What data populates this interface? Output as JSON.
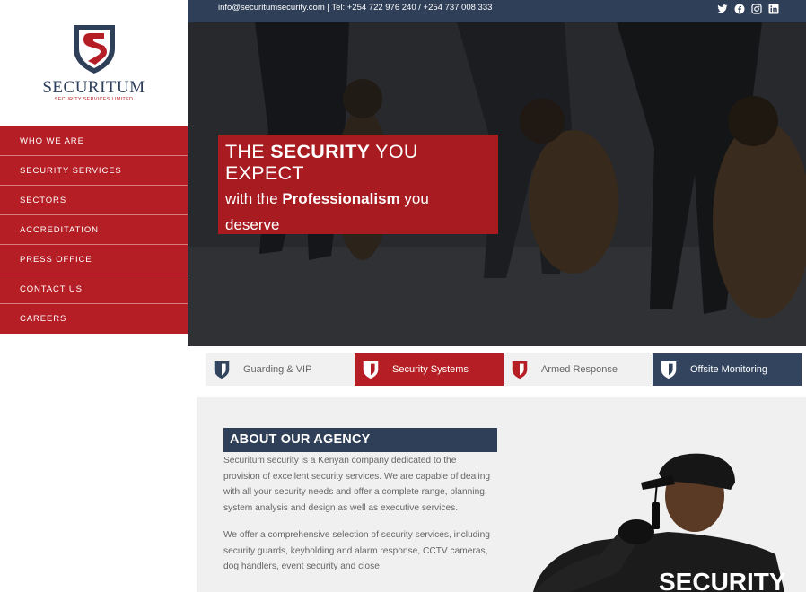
{
  "logo": {
    "name": "SECURITUM",
    "tagline": "SECURITY SERVICES LIMITED",
    "icon": "shield-logo-icon"
  },
  "nav": {
    "items": [
      {
        "label": "WHO WE ARE"
      },
      {
        "label": "SECURITY SERVICES"
      },
      {
        "label": "SECTORS"
      },
      {
        "label": "ACCREDITATION"
      },
      {
        "label": "PRESS OFFICE"
      },
      {
        "label": "CONTACT US"
      },
      {
        "label": "CAREERS"
      }
    ]
  },
  "topbar": {
    "contact": "info@securitumsecurity.com | Tel: +254 722 976 240 / +254 737 008 333",
    "socials": [
      "twitter-icon",
      "facebook-icon",
      "instagram-icon",
      "linkedin-icon"
    ]
  },
  "hero": {
    "line1_pre": "THE ",
    "line1_bold": "SECURITY",
    "line1_post": " YOU EXPECT",
    "line2_pre": "with the ",
    "line2_bold": "Professionalism",
    "line2_post": " you",
    "line3": "deserve"
  },
  "tabs": [
    {
      "label": "Guarding & VIP",
      "icon": "shield-icon"
    },
    {
      "label": "Security Systems",
      "icon": "shield-icon"
    },
    {
      "label": "Armed Response",
      "icon": "shield-icon"
    },
    {
      "label": "Offsite Monitoring",
      "icon": "shield-icon"
    }
  ],
  "about": {
    "heading": "ABOUT OUR AGENCY",
    "paragraph1": "Securitum security is a Kenyan company dedicated to the provision of excellent security services. We are capable of dealing with all your security needs and offer a complete range, planning, system analysis and design as well as executive services.",
    "paragraph2": "We offer a comprehensive selection of security services, including security guards, keyholding and alarm response, CCTV cameras, dog handlers, event security and close",
    "shirt_text": "SECURITY"
  },
  "colors": {
    "brand_red": "#b51e24",
    "brand_navy": "#2e3f57",
    "tab_grey": "#f1f1f2"
  }
}
